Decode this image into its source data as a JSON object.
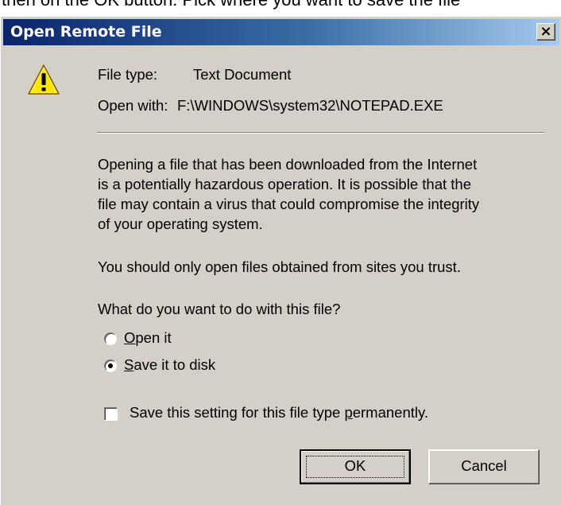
{
  "background": {
    "instruction_text": "then on the OK button. Pick where you want to save the file"
  },
  "dialog": {
    "title": "Open Remote File",
    "close_label": "×",
    "file_type_label": "File type:",
    "file_type_value": "Text Document",
    "open_with_label": "Open with:",
    "open_with_value": "F:\\WINDOWS\\system32\\NOTEPAD.EXE",
    "warning_lines": [
      "Opening a file that has been downloaded from the Internet",
      "is a potentially hazardous operation.  It is possible that the",
      "file may contain a virus that could compromise the integrity",
      "of your operating system."
    ],
    "trust_text": "You should only open files obtained from sites you trust.",
    "question": "What do you want to do with this file?",
    "options": [
      {
        "mnemonic": "O",
        "rest": "pen it",
        "selected": false
      },
      {
        "mnemonic": "S",
        "rest": "ave it to disk",
        "selected": true
      }
    ],
    "checkbox": {
      "prefix": "Save this setting for this file type ",
      "mnemonic": "p",
      "suffix": "ermanently.",
      "checked": false
    },
    "ok_label": "OK",
    "cancel_label": "Cancel",
    "icon": "warning-icon",
    "colors": {
      "face": "#d4d0c8",
      "title_start": "#0a246a",
      "title_end": "#a6caf0"
    }
  }
}
